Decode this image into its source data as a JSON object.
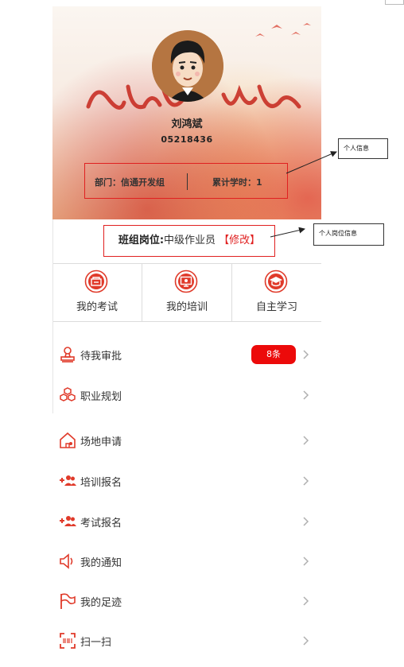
{
  "user": {
    "name": "刘鸿斌",
    "id": "05218436",
    "department": "部门：信通开发组",
    "study_hours": "累计学时：1"
  },
  "position": {
    "label": "班组岗位:",
    "value": "中级作业员",
    "edit": "【修改】"
  },
  "quick_actions": [
    {
      "label": "我的考试",
      "icon": "exam-icon"
    },
    {
      "label": "我的培训",
      "icon": "training-icon"
    },
    {
      "label": "自主学习",
      "icon": "graduation-cap-icon"
    }
  ],
  "menu": [
    {
      "label": "待我审批",
      "icon": "approval-stamp-icon",
      "badge": "8条"
    },
    {
      "label": "职业规划",
      "icon": "career-cubes-icon"
    },
    {
      "label": "场地申请",
      "icon": "venue-house-icon"
    },
    {
      "label": "培训报名",
      "icon": "add-users-icon"
    },
    {
      "label": "考试报名",
      "icon": "add-users-icon"
    },
    {
      "label": "我的通知",
      "icon": "speaker-icon"
    },
    {
      "label": "我的足迹",
      "icon": "flag-icon"
    },
    {
      "label": "扫一扫",
      "icon": "scan-icon"
    }
  ],
  "annotations": {
    "personal_info": "个人信息",
    "personal_position": "个人岗位信息"
  },
  "colors": {
    "accent": "#e02020",
    "badge": "#ec0a0a",
    "chevron": "#b0b0b0"
  }
}
